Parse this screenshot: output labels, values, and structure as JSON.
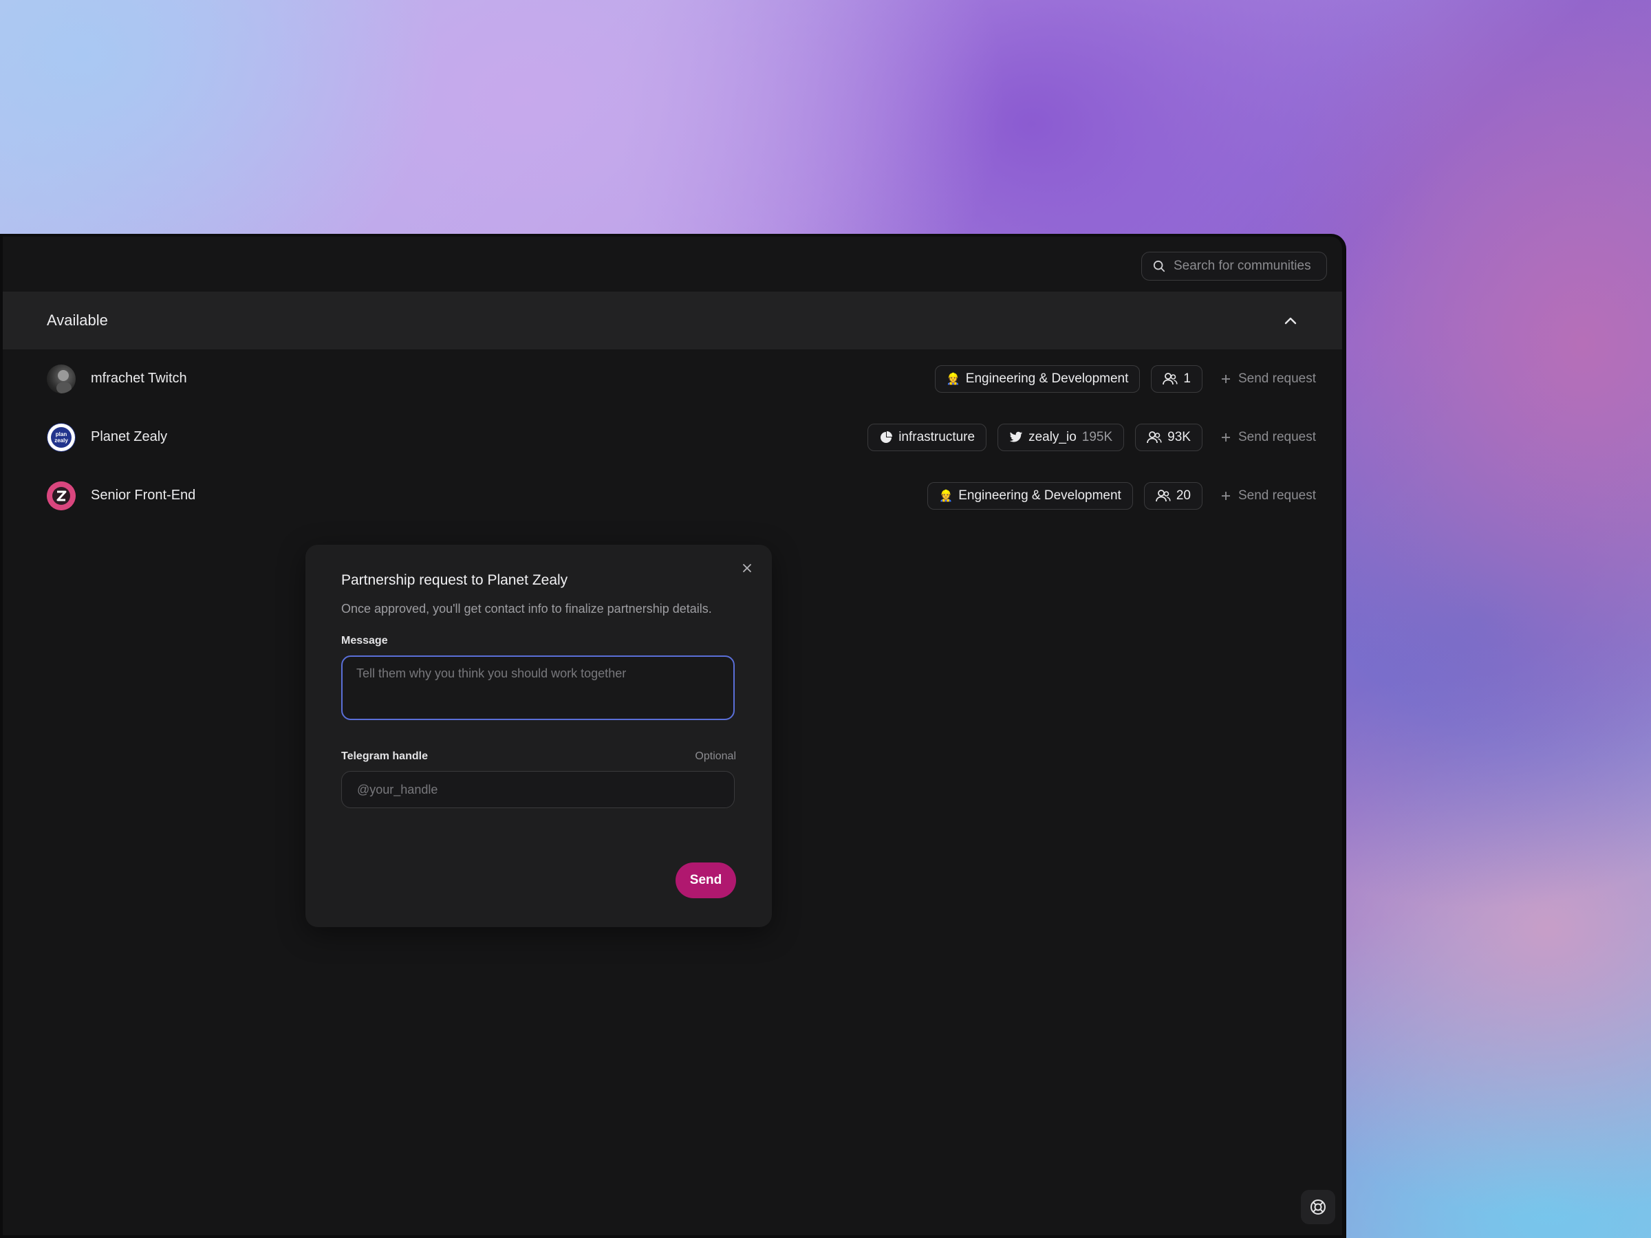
{
  "search": {
    "placeholder": "Search for communities"
  },
  "section": {
    "title": "Available"
  },
  "communities": [
    {
      "name": "mfrachet Twitch",
      "tags": [
        {
          "icon": "builder-emoji-icon",
          "label": "Engineering & Development"
        }
      ],
      "members": "1",
      "action": "Send request"
    },
    {
      "name": "Planet Zealy",
      "tags": [
        {
          "icon": "pie-chart-icon",
          "label": "infrastructure"
        }
      ],
      "twitter": {
        "handle": "zealy_io",
        "followers": "195K"
      },
      "members": "93K",
      "action": "Send request"
    },
    {
      "name": "Senior Front-End",
      "tags": [
        {
          "icon": "builder-emoji-icon",
          "label": "Engineering & Development"
        }
      ],
      "members": "20",
      "action": "Send request"
    }
  ],
  "dialog": {
    "title": "Partnership request to Planet Zealy",
    "description": "Once approved, you'll get contact info to finalize partnership details.",
    "message_label": "Message",
    "message_placeholder": "Tell them why you think you should work together",
    "message_value": "",
    "telegram_label": "Telegram handle",
    "telegram_optional": "Optional",
    "telegram_placeholder": "@your_handle",
    "telegram_value": "",
    "send_label": "Send"
  },
  "colors": {
    "accent": "#b0186f",
    "focus_ring": "#5a6fd8",
    "surface": "#151516",
    "dialog": "#1e1e1f"
  }
}
